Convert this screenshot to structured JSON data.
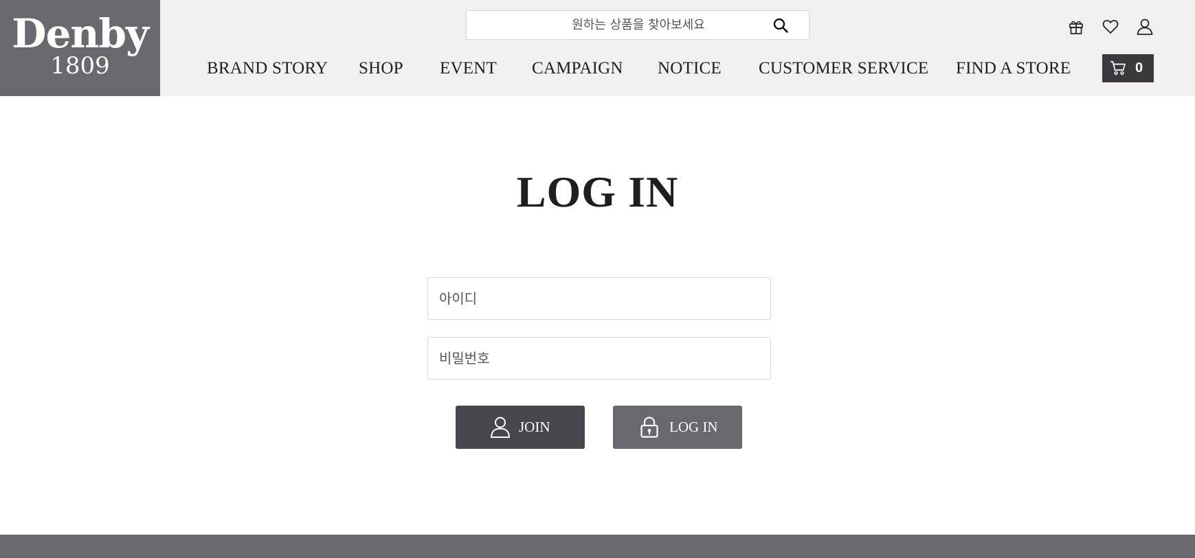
{
  "header": {
    "logo": {
      "brand": "Denby",
      "year": "1809"
    },
    "search": {
      "placeholder": "원하는 상품을 찾아보세요",
      "icon": "search-icon"
    },
    "utility_icons": [
      "gift-icon",
      "heart-icon",
      "user-icon"
    ],
    "nav": [
      "BRAND STORY",
      "SHOP",
      "EVENT",
      "CAMPAIGN",
      "NOTICE",
      "CUSTOMER SERVICE",
      "FIND A STORE"
    ],
    "cart": {
      "icon": "cart-icon",
      "count": "0"
    }
  },
  "main": {
    "title": "LOG IN",
    "id_field": {
      "placeholder": "아이디",
      "value": ""
    },
    "password_field": {
      "placeholder": "비밀번호",
      "value": ""
    },
    "join_button": {
      "label": "JOIN",
      "icon": "user-icon"
    },
    "login_button": {
      "label": "LOG IN",
      "icon": "lock-icon"
    }
  },
  "colors": {
    "header_bg": "#f1f0ee",
    "logo_bg": "#68686e",
    "join_button_bg": "#48484c",
    "login_button_bg": "#68686e",
    "cart_bg": "#3a3a3c",
    "footer_bg": "#68686e"
  }
}
